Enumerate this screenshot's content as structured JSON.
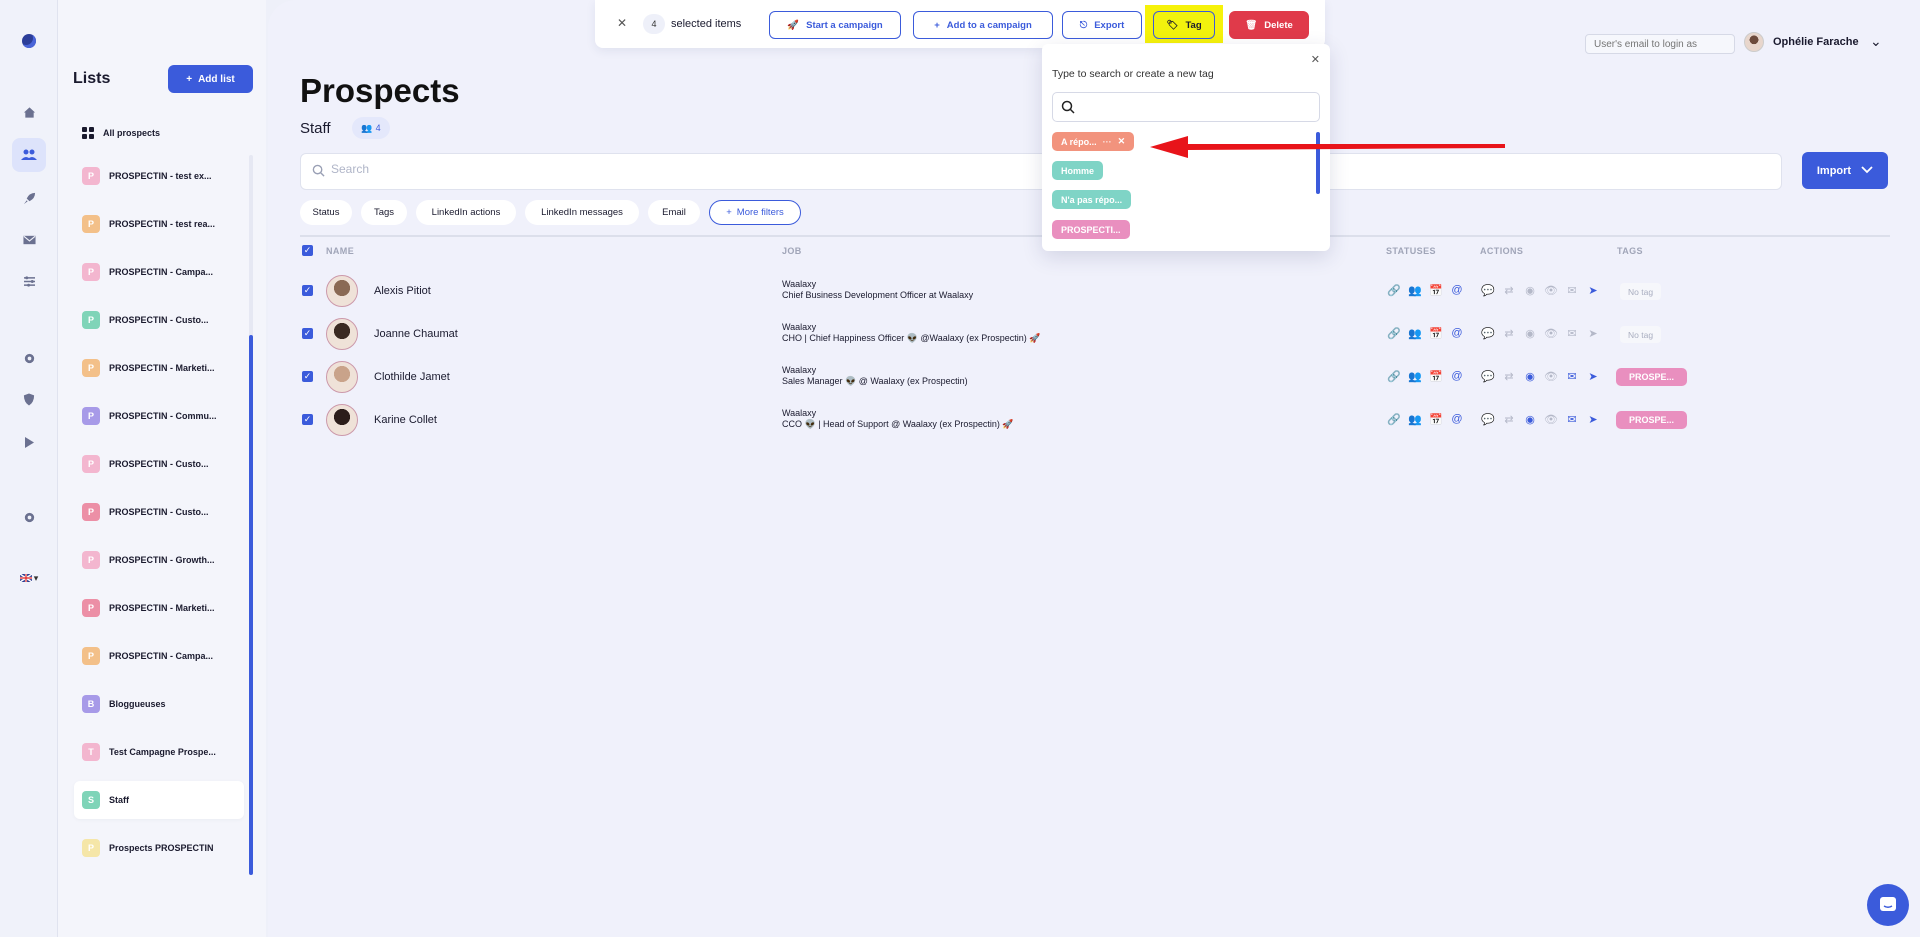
{
  "selection_bar": {
    "count": "4",
    "selected_label": "selected items",
    "start_campaign": "Start a campaign",
    "add_to_campaign": "Add to a campaign",
    "export": "Export",
    "tag": "Tag",
    "delete": "Delete"
  },
  "user": {
    "login_placeholder": "User's email to login as",
    "name": "Ophélie Farache"
  },
  "lists_panel": {
    "title": "Lists",
    "add_list": "Add list",
    "all_prospects": "All prospects",
    "items": [
      {
        "initial": "P",
        "label": "PROSPECTIN - test ex...",
        "color": "#f3b6cf"
      },
      {
        "initial": "P",
        "label": "PROSPECTIN - test rea...",
        "color": "#f3c089"
      },
      {
        "initial": "P",
        "label": "PROSPECTIN - Campa...",
        "color": "#f3b6cf"
      },
      {
        "initial": "P",
        "label": "PROSPECTIN - Custo...",
        "color": "#7fd4b8"
      },
      {
        "initial": "P",
        "label": "PROSPECTIN - Marketi...",
        "color": "#f3c089"
      },
      {
        "initial": "P",
        "label": "PROSPECTIN - Commu...",
        "color": "#a79ae8"
      },
      {
        "initial": "P",
        "label": "PROSPECTIN - Custo...",
        "color": "#f3b6cf"
      },
      {
        "initial": "P",
        "label": "PROSPECTIN - Custo...",
        "color": "#ec8fa6"
      },
      {
        "initial": "P",
        "label": "PROSPECTIN - Growth...",
        "color": "#f3b6cf"
      },
      {
        "initial": "P",
        "label": "PROSPECTIN - Marketi...",
        "color": "#ec8fa6"
      },
      {
        "initial": "P",
        "label": "PROSPECTIN - Campa...",
        "color": "#f3c089"
      },
      {
        "initial": "B",
        "label": "Bloggueuses",
        "color": "#a79ae8"
      },
      {
        "initial": "T",
        "label": "Test Campagne Prospe...",
        "color": "#f3b6cf"
      },
      {
        "initial": "S",
        "label": "Staff",
        "color": "#7fd4b8"
      },
      {
        "initial": "P",
        "label": "Prospects PROSPECTIN",
        "color": "#f5e6a8"
      }
    ]
  },
  "header": {
    "title": "Prospects",
    "subtitle": "Staff",
    "member_count": "4"
  },
  "search": {
    "placeholder": "Search"
  },
  "import_label": "Import",
  "filters": [
    "Status",
    "Tags",
    "LinkedIn actions",
    "LinkedIn messages",
    "Email"
  ],
  "more_filters": "More filters",
  "table": {
    "columns": {
      "name": "NAME",
      "job": "JOB",
      "statuses": "STATUSES",
      "actions": "ACTIONS",
      "tags": "TAGS"
    },
    "rows": [
      {
        "name": "Alexis Pitiot",
        "company": "Waalaxy",
        "job": "Chief Business Development Officer at Waalaxy",
        "tag": "No tag",
        "tag_type": "none"
      },
      {
        "name": "Joanne Chaumat",
        "company": "Waalaxy",
        "job": "CHO | Chief Happiness Officer 👽 @Waalaxy (ex Prospectin) 🚀",
        "tag": "No tag",
        "tag_type": "none"
      },
      {
        "name": "Clothilde Jamet",
        "company": "Waalaxy",
        "job": "Sales Manager 👽 @ Waalaxy (ex Prospectin)",
        "tag": "PROSPE...",
        "tag_type": "pill"
      },
      {
        "name": "Karine Collet",
        "company": "Waalaxy",
        "job": "CCO 👽 | Head of Support @ Waalaxy (ex Prospectin) 🚀",
        "tag": "PROSPE...",
        "tag_type": "pill"
      }
    ]
  },
  "tag_popup": {
    "hint": "Type to search or create a new tag",
    "options": [
      {
        "label": "A répo...",
        "color": "#f2937d"
      },
      {
        "label": "Homme",
        "color": "#7fd4c6"
      },
      {
        "label": "N'a pas répo...",
        "color": "#7fd4c6"
      },
      {
        "label": "PROSPECTI...",
        "color": "#e98fbf"
      }
    ]
  },
  "colors": {
    "accent": "#3b5bdb",
    "danger": "#e03a4a",
    "highlight": "#f2f20d",
    "annotation_arrow": "#e8141a"
  }
}
